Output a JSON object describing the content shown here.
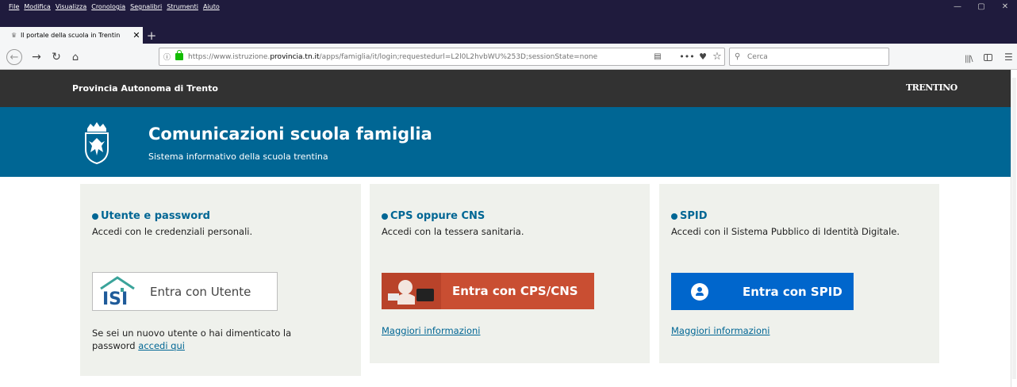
{
  "menubar": {
    "items": [
      "File",
      "Modifica",
      "Visualizza",
      "Cronologia",
      "Segnalibri",
      "Strumenti",
      "Aiuto"
    ]
  },
  "tab": {
    "title": "Il portale della scuola in Trentin"
  },
  "navbar": {
    "url_prefix": "https://www.istruzione.",
    "url_domain": "provincia.tn.it",
    "url_suffix": "/apps/famiglia/it/login;requestedurl=L2l0L2hvbWU%253D;sessionState=none",
    "search_placeholder": "Cerca"
  },
  "topbar": {
    "region_name": "Provincia Autonoma di Trento",
    "logo_text": "TRENTINO"
  },
  "header": {
    "title": "Comunicazioni scuola famiglia",
    "subtitle": "Sistema informativo della scuola trentina"
  },
  "cards": [
    {
      "title": "Utente e password",
      "description": "Accedi con le credenziali personali.",
      "button_label": "Entra con Utente",
      "note_text": "Se sei un nuovo utente o hai dimenticato la password",
      "note_link": "accedi qui"
    },
    {
      "title": "CPS oppure CNS",
      "description": "Accedi con la tessera sanitaria.",
      "button_label": "Entra con CPS/CNS",
      "more_info": "Maggiori informazioni"
    },
    {
      "title": "SPID",
      "description": "Accedi con il Sistema Pubblico di Identità Digitale.",
      "button_label": "Entra con SPID",
      "more_info": "Maggiori informazioni"
    }
  ],
  "colors": {
    "header_blue": "#006694",
    "topbar_dark": "#323232",
    "card_bg": "#eff1ec",
    "cps_button": "#c94e32",
    "spid_button": "#0066cc"
  }
}
